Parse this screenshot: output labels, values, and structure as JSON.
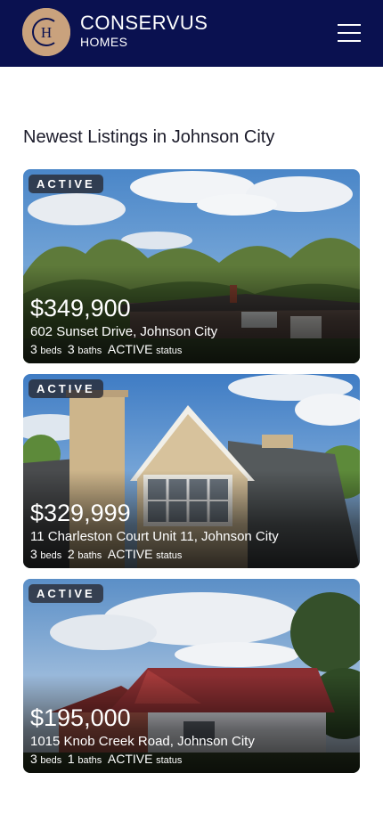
{
  "header": {
    "logo_letters": "CH",
    "brand_line1": "CONSERVUS",
    "brand_line2": "HOMES"
  },
  "section_title": "Newest Listings in Johnson City",
  "listings": [
    {
      "badge": "ACTIVE",
      "price": "$349,900",
      "address": "602 Sunset Drive, Johnson City",
      "beds": "3",
      "beds_label": "beds",
      "baths": "3",
      "baths_label": "baths",
      "status": "ACTIVE",
      "status_label": "status"
    },
    {
      "badge": "ACTIVE",
      "price": "$329,999",
      "address": "11 Charleston Court Unit 11, Johnson City",
      "beds": "3",
      "beds_label": "beds",
      "baths": "2",
      "baths_label": "baths",
      "status": "ACTIVE",
      "status_label": "status"
    },
    {
      "badge": "ACTIVE",
      "price": "$195,000",
      "address": "1015 Knob Creek Road, Johnson City",
      "beds": "3",
      "beds_label": "beds",
      "baths": "1",
      "baths_label": "baths",
      "status": "ACTIVE",
      "status_label": "status"
    }
  ]
}
